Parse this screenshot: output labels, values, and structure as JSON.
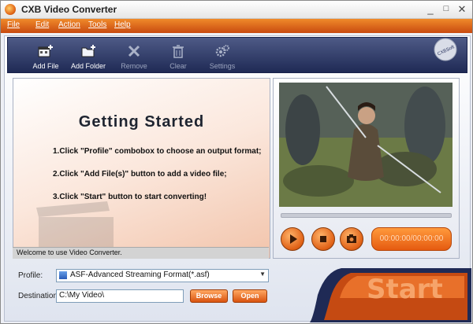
{
  "window": {
    "title": "CXB Video Converter",
    "controls": [
      "_",
      "□",
      "✕"
    ]
  },
  "menu": [
    {
      "label": "File"
    },
    {
      "label": "Edit"
    },
    {
      "label": "Action"
    },
    {
      "label": "Tools"
    },
    {
      "label": "Help"
    }
  ],
  "toolbar": {
    "buttons": [
      {
        "label": "Add File",
        "icon": "film-plus-icon",
        "enabled": true
      },
      {
        "label": "Add Folder",
        "icon": "folder-plus-icon",
        "enabled": true
      },
      {
        "label": "Remove",
        "icon": "x-icon",
        "enabled": false
      },
      {
        "label": "Clear",
        "icon": "trash-icon",
        "enabled": false
      },
      {
        "label": "Settings",
        "icon": "gears-icon",
        "enabled": false
      }
    ],
    "brand_badge": "CXBSoft"
  },
  "getting_started": {
    "title": "Getting Started",
    "steps": [
      "1.Click \"Profile\" combobox to choose an output format;",
      "2.Click \"Add File(s)\" button to add a video file;",
      "3.Click \"Start\" button to start converting!"
    ]
  },
  "status": {
    "text": "Welcome to use Video Converter."
  },
  "player": {
    "time": "00:00:00/00:00:00",
    "progress": 0
  },
  "profile": {
    "label": "Profile:",
    "value": "ASF-Advanced Streaming Format(*.asf)"
  },
  "destination": {
    "label": "Destination:",
    "value": "C:\\My Video\\",
    "browse_label": "Browse",
    "open_label": "Open"
  },
  "start": {
    "label": "Start"
  },
  "colors": {
    "accent": "#e8641a",
    "toolbar": "#2a3560",
    "menubar": "#d9581a"
  }
}
